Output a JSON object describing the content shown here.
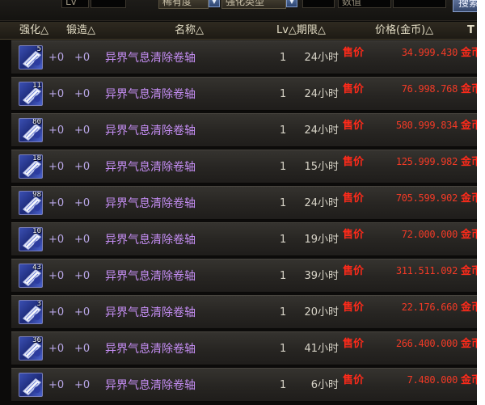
{
  "filter_bar": {
    "fields": [
      "Lv",
      "稀有度",
      "强化类型",
      "数值"
    ],
    "search_label": "搜索"
  },
  "headers": {
    "strength": "强化△",
    "forge": "锻造△",
    "name": "名称△",
    "lv_duration": "Lv△期限△",
    "price": "价格(金币)△",
    "tool": "T"
  },
  "colors": {
    "item_name": "#c58ef4",
    "price": "#f23a26",
    "header_text": "#e2dcc4"
  },
  "rows": [
    {
      "count": "5",
      "strength": "+0",
      "forge": "+0",
      "name": "异界气息清除卷轴",
      "lv": "1",
      "duration": "24小时",
      "sale_label": "售价",
      "price": "34.999.430",
      "currency": "金币",
      "icon": "scroll-icon"
    },
    {
      "count": "11",
      "strength": "+0",
      "forge": "+0",
      "name": "异界气息清除卷轴",
      "lv": "1",
      "duration": "24小时",
      "sale_label": "售价",
      "price": "76.998.768",
      "currency": "金币",
      "icon": "scroll-icon"
    },
    {
      "count": "80",
      "strength": "+0",
      "forge": "+0",
      "name": "异界气息清除卷轴",
      "lv": "1",
      "duration": "24小时",
      "sale_label": "售价",
      "price": "580.999.834",
      "currency": "金币",
      "icon": "scroll-icon"
    },
    {
      "count": "18",
      "strength": "+0",
      "forge": "+0",
      "name": "异界气息清除卷轴",
      "lv": "1",
      "duration": "15小时",
      "sale_label": "售价",
      "price": "125.999.982",
      "currency": "金币",
      "icon": "scroll-icon"
    },
    {
      "count": "98",
      "strength": "+0",
      "forge": "+0",
      "name": "异界气息清除卷轴",
      "lv": "1",
      "duration": "24小时",
      "sale_label": "售价",
      "price": "705.599.902",
      "currency": "金币",
      "icon": "scroll-icon"
    },
    {
      "count": "10",
      "strength": "+0",
      "forge": "+0",
      "name": "异界气息清除卷轴",
      "lv": "1",
      "duration": "19小时",
      "sale_label": "售价",
      "price": "72.000.000",
      "currency": "金币",
      "icon": "scroll-icon"
    },
    {
      "count": "43",
      "strength": "+0",
      "forge": "+0",
      "name": "异界气息清除卷轴",
      "lv": "1",
      "duration": "39小时",
      "sale_label": "售价",
      "price": "311.511.092",
      "currency": "金币",
      "icon": "scroll-icon"
    },
    {
      "count": "3",
      "strength": "+0",
      "forge": "+0",
      "name": "异界气息清除卷轴",
      "lv": "1",
      "duration": "20小时",
      "sale_label": "售价",
      "price": "22.176.660",
      "currency": "金币",
      "icon": "scroll-icon"
    },
    {
      "count": "36",
      "strength": "+0",
      "forge": "+0",
      "name": "异界气息清除卷轴",
      "lv": "1",
      "duration": "41小时",
      "sale_label": "售价",
      "price": "266.400.000",
      "currency": "金币",
      "icon": "scroll-icon"
    },
    {
      "count": "",
      "strength": "+0",
      "forge": "+0",
      "name": "异界气息清除卷轴",
      "lv": "1",
      "duration": "6小时",
      "sale_label": "售价",
      "price": "7.480.000",
      "currency": "金币",
      "icon": "scroll-icon"
    }
  ]
}
